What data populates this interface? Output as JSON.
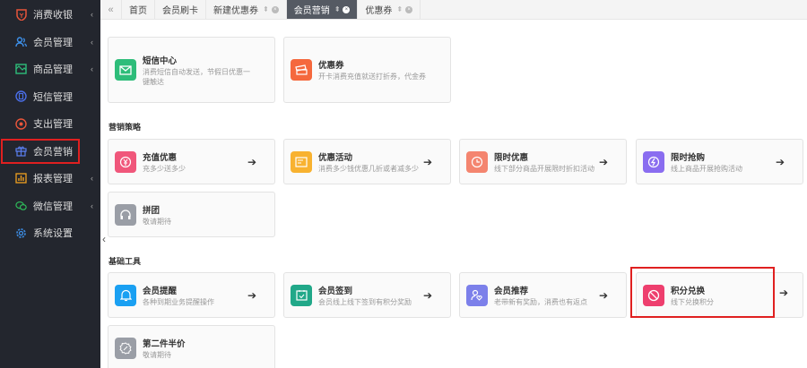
{
  "sidebar": {
    "items": [
      {
        "label": "消费收银",
        "icon": "shield-icon",
        "has_chevron": true
      },
      {
        "label": "会员管理",
        "icon": "users-icon",
        "has_chevron": true
      },
      {
        "label": "商品管理",
        "icon": "image-icon",
        "has_chevron": true
      },
      {
        "label": "短信管理",
        "icon": "message-icon",
        "has_chevron": false
      },
      {
        "label": "支出管理",
        "icon": "coin-icon",
        "has_chevron": false
      },
      {
        "label": "会员营销",
        "icon": "gift-icon",
        "has_chevron": false
      },
      {
        "label": "报表管理",
        "icon": "chart-icon",
        "has_chevron": true
      },
      {
        "label": "微信管理",
        "icon": "wechat-icon",
        "has_chevron": true
      },
      {
        "label": "系统设置",
        "icon": "settings-icon",
        "has_chevron": false
      }
    ],
    "chevron": "‹",
    "collapse_arrow": "‹"
  },
  "tabs": {
    "back": "«",
    "items": [
      {
        "label": "首页"
      },
      {
        "label": "会员刷卡"
      },
      {
        "label": "新建优惠券",
        "pin": "⇞",
        "close": "×"
      },
      {
        "label": "会员营销",
        "pin": "⇞",
        "close": "×"
      },
      {
        "label": "优惠券",
        "pin": "⇞",
        "close": "×"
      }
    ]
  },
  "sections": {
    "strategy": "营销策略",
    "tools": "基础工具"
  },
  "cards": {
    "sms": {
      "title": "短信中心",
      "desc": "消费短信自动发送，节假日优惠一键触达"
    },
    "coupon": {
      "title": "优惠券",
      "desc": "开卡消费充值就送打折券，代金券"
    },
    "recharge": {
      "title": "充值优惠",
      "desc": "充多少送多少"
    },
    "promo": {
      "title": "优惠活动",
      "desc": "消费多少钱优惠几折或者减多少"
    },
    "limited": {
      "title": "限时优惠",
      "desc": "线下部分商品开展限时折扣活动"
    },
    "flash": {
      "title": "限时抢购",
      "desc": "线上商品开展抢购活动"
    },
    "group": {
      "title": "拼团",
      "desc": "敬请期待"
    },
    "remind": {
      "title": "会员提醒",
      "desc": "各种到期业务提醒操作"
    },
    "signin": {
      "title": "会员签到",
      "desc": "会员线上线下签到有积分奖励"
    },
    "referral": {
      "title": "会员推荐",
      "desc": "老带新有奖励，消费也有返点"
    },
    "points": {
      "title": "积分兑换",
      "desc": "线下兑换积分"
    },
    "halfprice": {
      "title": "第二件半价",
      "desc": "敬请期待"
    }
  },
  "arrow": "➔",
  "colors": {
    "green": "#2ebd7a",
    "orange": "#f5683d",
    "pink": "#f0577b",
    "yellow": "#f8b230",
    "salmon": "#f4856f",
    "purple": "#8a6df0",
    "gray": "#9a9ea6",
    "blue": "#1aa0f2",
    "teal": "#21a889",
    "violet": "#7c80ea",
    "rose": "#ee3f6e",
    "highlight": "#e02020"
  }
}
